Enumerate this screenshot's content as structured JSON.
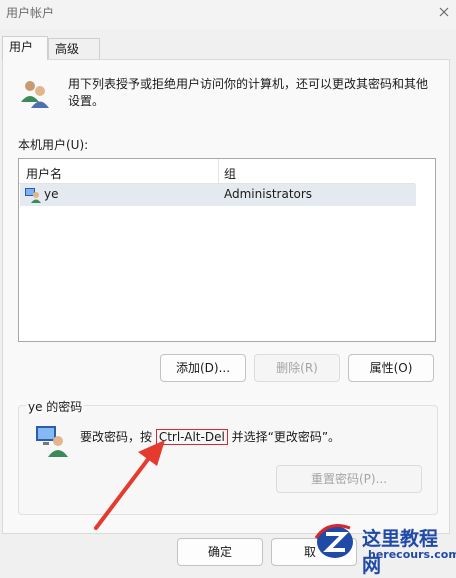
{
  "window": {
    "title": "用户帐户"
  },
  "tabs": [
    {
      "label": "用户"
    },
    {
      "label": "高级"
    }
  ],
  "description": "用下列表授予或拒绝用户访问你的计算机，还可以更改其密码和其他设置。",
  "users_list": {
    "label": "本机用户(U):",
    "columns": [
      "用户名",
      "组"
    ],
    "rows": [
      {
        "username": "ye",
        "group": "Administrators"
      }
    ]
  },
  "buttons": {
    "add": "添加(D)...",
    "remove": "删除(R)",
    "properties": "属性(O)"
  },
  "password_group": {
    "title": "ye 的密码",
    "text_before": "要改密码，按 ",
    "shortcut": "Ctrl-Alt-Del",
    "text_after": " 并选择“更改密码”。",
    "reset_button": "重置密码(P)..."
  },
  "footer": {
    "ok": "确定",
    "cancel": "取"
  },
  "watermark": {
    "title": "这里教程网",
    "url": "herecours.com"
  },
  "colors": {
    "highlight": "#d9272b",
    "arrow": "#e53b2f",
    "selection": "#e5eaf0"
  }
}
